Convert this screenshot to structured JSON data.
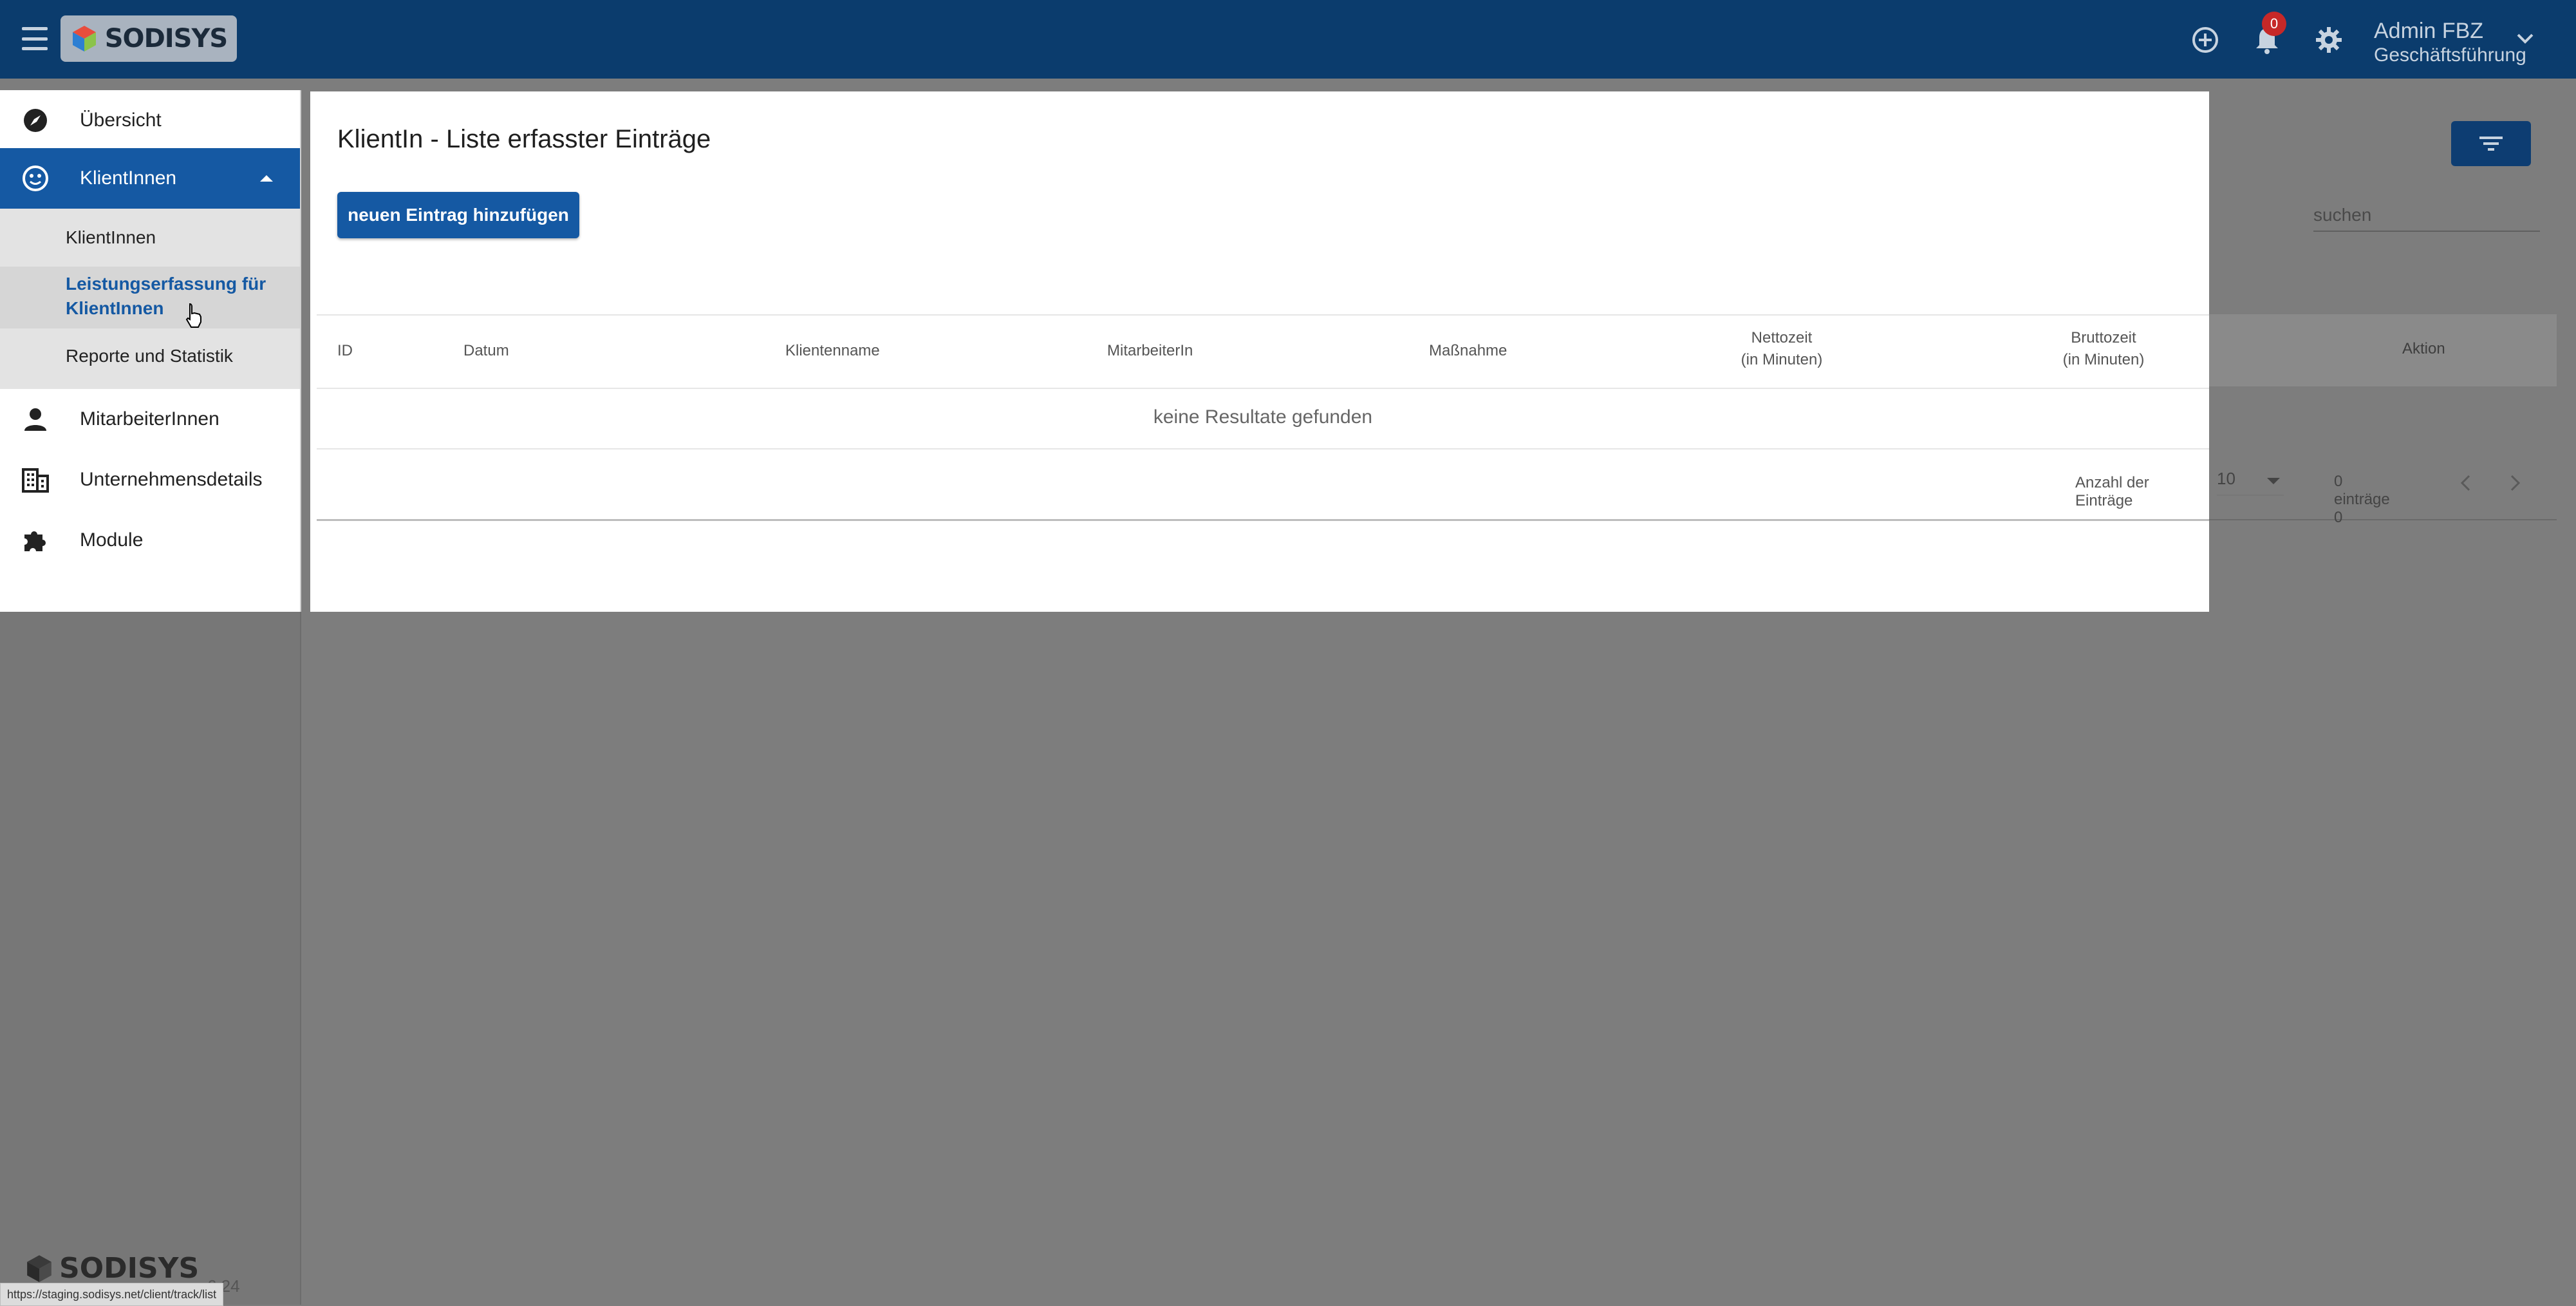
{
  "header": {
    "logo_text": "SODISYS",
    "notification_count": "0",
    "user_name": "Admin FBZ",
    "user_role": "Geschäftsführung",
    "icons": [
      "menu-icon",
      "add-circle-icon",
      "bell-icon",
      "gear-icon",
      "chevron-down-icon"
    ]
  },
  "sidebar": {
    "items": [
      {
        "label": "Übersicht",
        "icon": "compass-icon"
      },
      {
        "label": "KlientInnen",
        "icon": "smiley-icon",
        "expanded": true
      },
      {
        "label": "MitarbeiterInnen",
        "icon": "person-icon"
      },
      {
        "label": "Unternehmensdetails",
        "icon": "building-icon"
      },
      {
        "label": "Module",
        "icon": "puzzle-icon"
      }
    ],
    "subitems": [
      {
        "label": "KlientInnen"
      },
      {
        "label": "Leistungserfassung für KlientInnen",
        "selected": true
      },
      {
        "label": "Reporte und Statistik"
      }
    ]
  },
  "background": {
    "search_placeholder": "suchen",
    "aktion_header": "Aktion"
  },
  "modal": {
    "title": "KlientIn - Liste erfasster Einträge",
    "add_button": "neuen Eintrag hinzufügen",
    "columns": [
      "ID",
      "Datum",
      "Klientenname",
      "MitarbeiterIn",
      "Maßnahme",
      "Nettozeit",
      "(in Minuten)",
      "Bruttozeit",
      "(in Minuten)"
    ],
    "empty_message": "keine Resultate gefunden",
    "pager": {
      "label": "Anzahl der Einträge",
      "page_size": "10",
      "count_text": "0 einträge 0"
    }
  },
  "footer": {
    "logo_text": "SODISYS",
    "version": "6.24",
    "status_url": "https://staging.sodisys.net/client/track/list"
  },
  "colors": {
    "header_bg": "#0b3c6d",
    "primary": "#1559a3",
    "overlay": "#7d7d7d",
    "badge": "#c62828"
  }
}
